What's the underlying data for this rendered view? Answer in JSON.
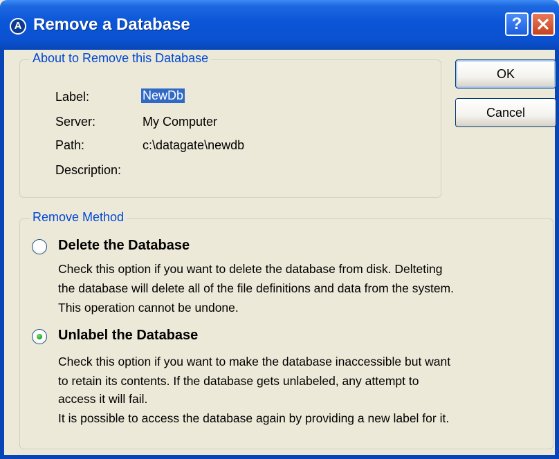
{
  "window": {
    "title": "Remove a Database",
    "app_icon": "A",
    "help_label": "?"
  },
  "about_group": {
    "title": "About to Remove this Database",
    "label_caption": "Label:",
    "label_value": "NewDb",
    "server_caption": "Server:",
    "server_value": "My Computer",
    "path_caption": "Path:",
    "path_value": "c:\\datagate\\newdb",
    "description_caption": "Description:",
    "description_value": ""
  },
  "buttons": {
    "ok": "OK",
    "cancel": "Cancel"
  },
  "method_group": {
    "title": "Remove Method",
    "options": [
      {
        "label": "Delete the Database",
        "selected": false,
        "lines": [
          "Check this option if you want to delete the database from disk. Delteting",
          "the database will delete all of the file definitions and data from the system.",
          "This operation cannot be undone."
        ]
      },
      {
        "label": "Unlabel the Database",
        "selected": true,
        "lines": [
          "Check this option if you want to make the database inaccessible but want",
          "to retain its contents.  If the database gets unlabeled, any attempt to",
          "access it will fail.",
          "It is possible to access the database again by providing a new label for it."
        ]
      }
    ]
  },
  "colors": {
    "titlebar": "#0A55D8",
    "group_title": "#0046D5",
    "selection": "#316AC5",
    "radio_dot": "#21A121",
    "background": "#ECE9D8"
  },
  "icons": {
    "app": "app-logo-icon",
    "help": "help-icon",
    "close": "close-icon"
  }
}
